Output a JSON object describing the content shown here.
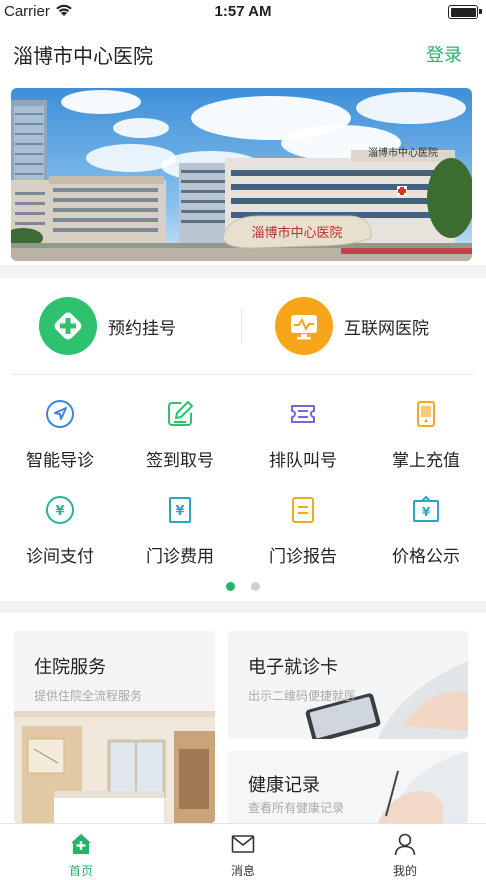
{
  "status_bar": {
    "carrier": "Carrier",
    "time": "1:57 AM"
  },
  "header": {
    "title": "淄博市中心医院",
    "login": "登录"
  },
  "banner": {
    "sign_text": "淄博市中心医院",
    "roof_text": "淄博市中心医院"
  },
  "big_services": [
    {
      "label": "预约挂号",
      "icon": "plus-cross-icon",
      "color": "#2ec26f"
    },
    {
      "label": "互联网医院",
      "icon": "monitor-pulse-icon",
      "color": "#f7a51a"
    }
  ],
  "grid_services": [
    {
      "label": "智能导诊",
      "icon": "navigation-arrow-icon",
      "color": "#3b86d9"
    },
    {
      "label": "签到取号",
      "icon": "edit-pen-icon",
      "color": "#2ec26f"
    },
    {
      "label": "排队叫号",
      "icon": "ticket-icon",
      "color": "#7a65d8"
    },
    {
      "label": "掌上充值",
      "icon": "phone-recharge-icon",
      "color": "#f5a623"
    },
    {
      "label": "诊间支付",
      "icon": "yuan-circle-icon",
      "color": "#2bb39a"
    },
    {
      "label": "门诊费用",
      "icon": "yuan-receipt-icon",
      "color": "#2aa6c4"
    },
    {
      "label": "门诊报告",
      "icon": "report-document-icon",
      "color": "#f5a623"
    },
    {
      "label": "价格公示",
      "icon": "yuan-board-icon",
      "color": "#2aa6c4"
    }
  ],
  "pager": {
    "active": 0,
    "count": 2
  },
  "cards": {
    "inpatient": {
      "title": "住院服务",
      "subtitle": "提供住院全流程服务"
    },
    "ecard": {
      "title": "电子就诊卡",
      "subtitle": "出示二维码便捷就医"
    },
    "health": {
      "title": "健康记录",
      "subtitle": "查看所有健康记录"
    }
  },
  "tabs": [
    {
      "label": "首页",
      "icon": "home-plus-icon",
      "active": true
    },
    {
      "label": "消息",
      "icon": "mail-icon",
      "active": false
    },
    {
      "label": "我的",
      "icon": "user-icon",
      "active": false
    }
  ],
  "colors": {
    "accent": "#27b26a",
    "tab_inactive": "#333333"
  }
}
